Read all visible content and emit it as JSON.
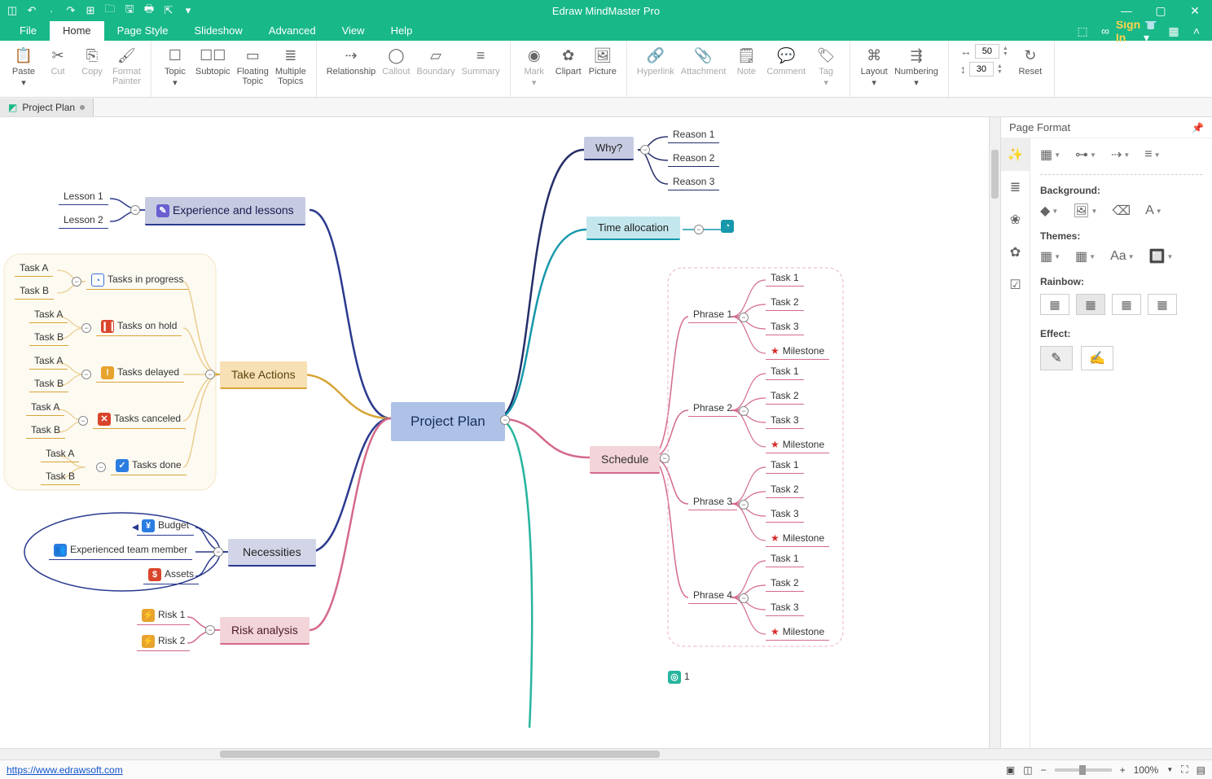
{
  "app": {
    "title": "Edraw MindMaster Pro"
  },
  "menu": {
    "file": "File",
    "home": "Home",
    "pagestyle": "Page Style",
    "slideshow": "Slideshow",
    "advanced": "Advanced",
    "view": "View",
    "help": "Help",
    "signin": "Sign In"
  },
  "ribbon": {
    "paste": "Paste",
    "cut": "Cut",
    "copy": "Copy",
    "formatpainter": "Format\nPainter",
    "topic": "Topic",
    "subtopic": "Subtopic",
    "floating": "Floating\nTopic",
    "multiple": "Multiple\nTopics",
    "relationship": "Relationship",
    "callout": "Callout",
    "boundary": "Boundary",
    "summary": "Summary",
    "mark": "Mark",
    "clipart": "Clipart",
    "picture": "Picture",
    "hyperlink": "Hyperlink",
    "attachment": "Attachment",
    "note": "Note",
    "comment": "Comment",
    "tag": "Tag",
    "layout": "Layout",
    "numbering": "Numbering",
    "hspace": "50",
    "vspace": "30",
    "reset": "Reset"
  },
  "doctab": {
    "name": "Project Plan"
  },
  "panel": {
    "title": "Page Format",
    "background": "Background:",
    "themes": "Themes:",
    "rainbow": "Rainbow:",
    "effect": "Effect:"
  },
  "status": {
    "link": "https://www.edrawsoft.com",
    "zoom": "100%"
  },
  "mm": {
    "center": "Project Plan",
    "why": "Why?",
    "reasons": [
      "Reason 1",
      "Reason 2",
      "Reason 3"
    ],
    "time": "Time allocation",
    "schedule": "Schedule",
    "phrases": [
      "Phrase 1",
      "Phrase 2",
      "Phrase 3",
      "Phrase 4"
    ],
    "ptasks": [
      "Task 1",
      "Task 2",
      "Task 3",
      "Milestone"
    ],
    "exp": "Experience and lessons",
    "lessons": [
      "Lesson 1",
      "Lesson 2"
    ],
    "take": "Take Actions",
    "tasks": {
      "progress": "Tasks in progress",
      "hold": "Tasks on hold",
      "delayed": "Tasks delayed",
      "canceled": "Tasks canceled",
      "done": "Tasks done"
    },
    "tab": [
      "Task A",
      "Task B"
    ],
    "nec": "Necessities",
    "necitems": {
      "budget": "Budget",
      "team": "Experienced team member",
      "assets": "Assets"
    },
    "risk": "Risk analysis",
    "risks": [
      "Risk 1",
      "Risk 2"
    ],
    "targetnum": "1"
  }
}
